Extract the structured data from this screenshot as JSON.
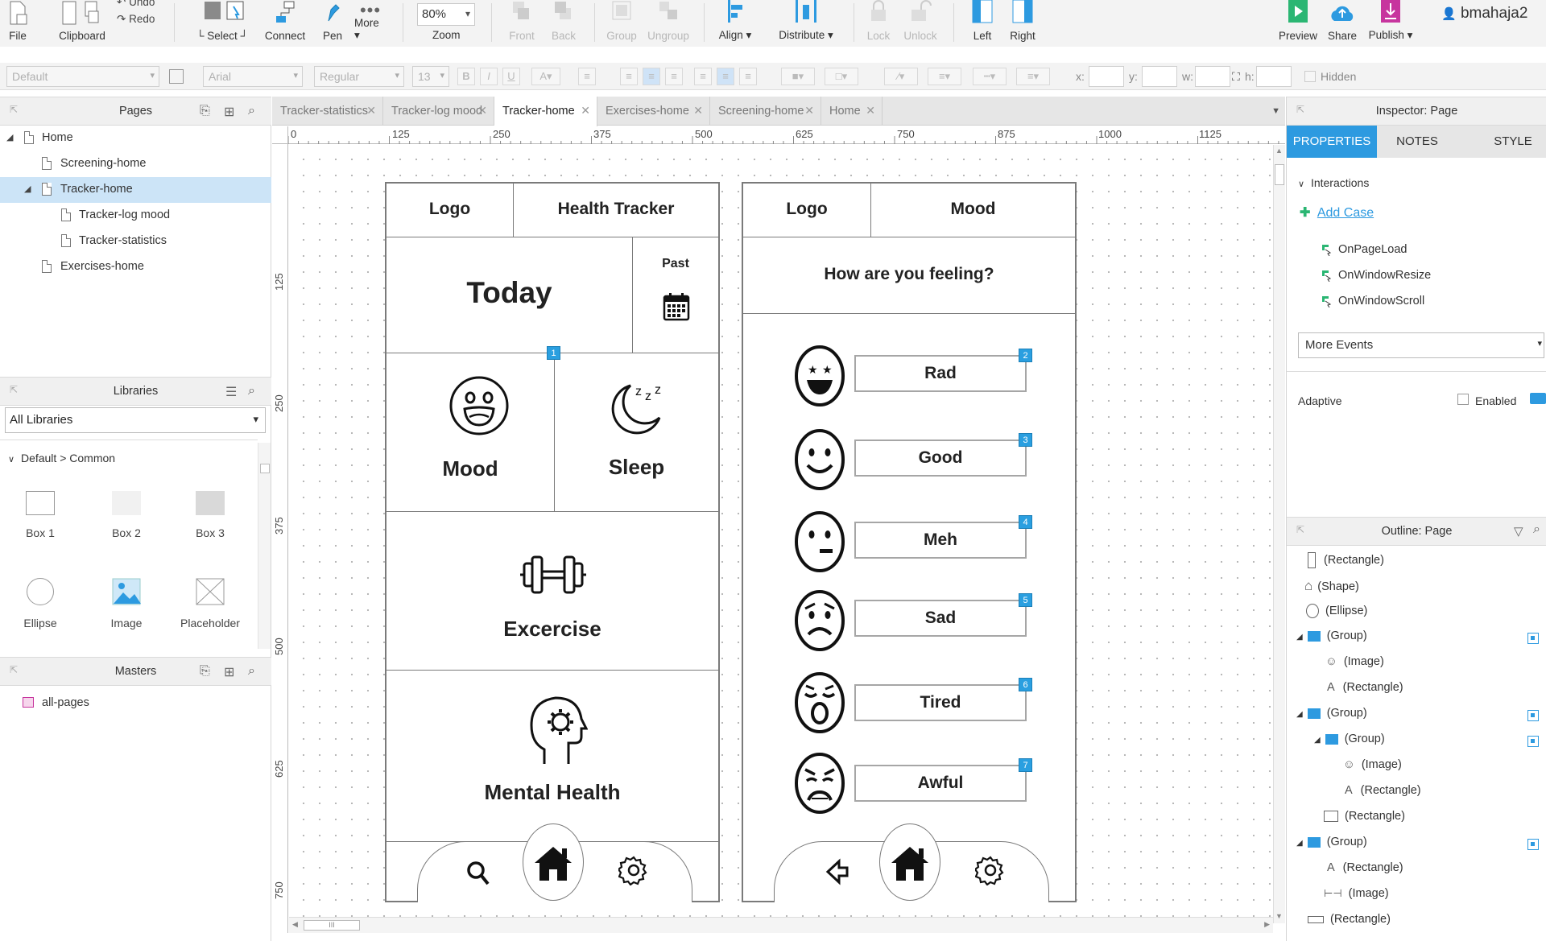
{
  "toolbar": {
    "file": "File",
    "clipboard": "Clipboard",
    "undo": "Undo",
    "redo": "Redo",
    "select": "Select",
    "connect": "Connect",
    "pen": "Pen",
    "more": "More ▾",
    "zoom_value": "80%",
    "zoom_label": "Zoom",
    "front": "Front",
    "back": "Back",
    "group": "Group",
    "ungroup": "Ungroup",
    "align": "Align ▾",
    "distribute": "Distribute ▾",
    "lock": "Lock",
    "unlock": "Unlock",
    "left": "Left",
    "right": "Right",
    "preview": "Preview",
    "share": "Share",
    "publish": "Publish ▾",
    "user": "bmahaja2"
  },
  "formatbar": {
    "style": "Default",
    "font": "Arial",
    "weight": "Regular",
    "size": "13",
    "x_label": "x:",
    "y_label": "y:",
    "w_label": "w:",
    "h_label": "h:",
    "hidden_label": "Hidden"
  },
  "pages_panel": {
    "title": "Pages",
    "items": [
      {
        "label": "Home"
      },
      {
        "label": "Screening-home"
      },
      {
        "label": "Tracker-home"
      },
      {
        "label": "Tracker-log mood"
      },
      {
        "label": "Tracker-statistics"
      },
      {
        "label": "Exercises-home"
      }
    ]
  },
  "libraries_panel": {
    "title": "Libraries",
    "select_value": "All Libraries",
    "group": "Default > Common",
    "widgets": [
      {
        "label": "Box 1"
      },
      {
        "label": "Box 2"
      },
      {
        "label": "Box 3"
      },
      {
        "label": "Ellipse"
      },
      {
        "label": "Image"
      },
      {
        "label": "Placeholder"
      }
    ]
  },
  "masters_panel": {
    "title": "Masters",
    "items": [
      {
        "label": "all-pages"
      }
    ]
  },
  "tabs": [
    {
      "label": "Tracker-statistics"
    },
    {
      "label": "Tracker-log mood"
    },
    {
      "label": "Tracker-home"
    },
    {
      "label": "Exercises-home"
    },
    {
      "label": "Screening-home"
    },
    {
      "label": "Home"
    }
  ],
  "ruler": {
    "h": [
      "0",
      "125",
      "250",
      "375",
      "500",
      "625",
      "750",
      "875",
      "1000",
      "1125"
    ],
    "v": [
      "125",
      "250",
      "375",
      "500",
      "625",
      "750"
    ]
  },
  "mock_home": {
    "logo": "Logo",
    "title": "Health Tracker",
    "today": "Today",
    "past": "Past",
    "mood": "Mood",
    "sleep": "Sleep",
    "exercise": "Excercise",
    "mental": "Mental Health",
    "marker": "1"
  },
  "mock_mood": {
    "logo": "Logo",
    "title": "Mood",
    "question": "How are you feeling?",
    "options": [
      {
        "label": "Rad",
        "marker": "2"
      },
      {
        "label": "Good",
        "marker": "3"
      },
      {
        "label": "Meh",
        "marker": "4"
      },
      {
        "label": "Sad",
        "marker": "5"
      },
      {
        "label": "Tired",
        "marker": "6"
      },
      {
        "label": "Awful",
        "marker": "7"
      }
    ]
  },
  "inspector": {
    "title": "Inspector: Page",
    "tabs": [
      "PROPERTIES",
      "NOTES",
      "STYLE"
    ],
    "interactions": "Interactions",
    "add_case": "Add Case",
    "events": [
      "OnPageLoad",
      "OnWindowResize",
      "OnWindowScroll"
    ],
    "more_events": "More Events",
    "adaptive": "Adaptive",
    "enabled": "Enabled"
  },
  "outline": {
    "title": "Outline: Page",
    "items": [
      {
        "label": "(Rectangle)"
      },
      {
        "label": "(Shape)"
      },
      {
        "label": "(Ellipse)"
      },
      {
        "label": "(Group)"
      },
      {
        "label": "(Image)"
      },
      {
        "label": "(Rectangle)"
      },
      {
        "label": "(Group)"
      },
      {
        "label": "(Group)"
      },
      {
        "label": "(Image)"
      },
      {
        "label": "(Rectangle)"
      },
      {
        "label": "(Rectangle)"
      },
      {
        "label": "(Group)"
      },
      {
        "label": "(Rectangle)"
      },
      {
        "label": "(Image)"
      },
      {
        "label": "(Rectangle)"
      }
    ]
  },
  "colors": {
    "accent": "#2d9ae0",
    "selection": "#cce4f7",
    "green": "#2bb673"
  }
}
